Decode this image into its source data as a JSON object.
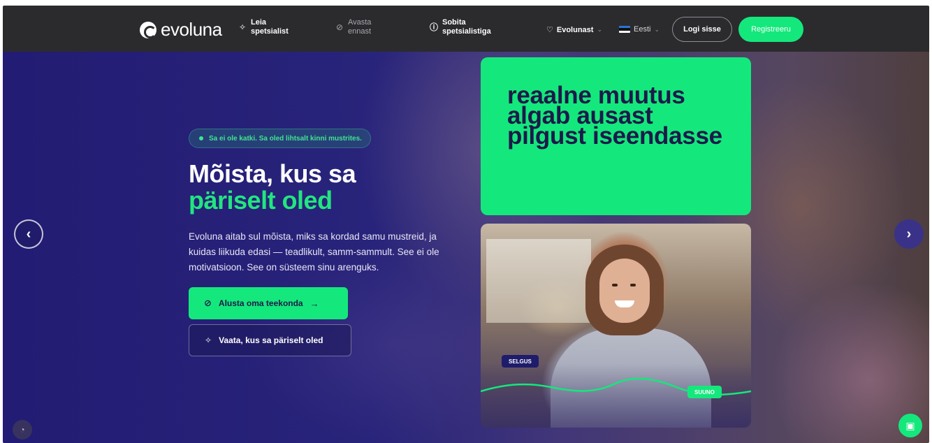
{
  "brand": {
    "name": "evoluna"
  },
  "nav": {
    "items": [
      {
        "line1": "Leia",
        "line2": "spetsialist",
        "icon": "sparkle-icon"
      },
      {
        "line1": "Avasta",
        "line2": "ennast",
        "icon": "compass-icon"
      },
      {
        "line1": "Sobita",
        "line2": "spetsialistiga",
        "icon": "info-icon"
      }
    ],
    "evolunast": "Evolunast",
    "language": "Eesti",
    "login": "Logi sisse",
    "register": "Registreeru"
  },
  "hero": {
    "tagline": "Sa ei ole katki. Sa oled lihtsalt kinni mustrites.",
    "headline_white": "Mõista, kus sa",
    "headline_green": "päriselt oled",
    "lead": "Evoluna aitab sul mõista, miks sa kordad samu mustreid, ja kuidas liikuda edasi — teadlikult, samm-sammult. See ei ole motivatsioon. See on süsteem sinu arenguks.",
    "cta_primary": "Alusta oma teekonda",
    "cta_secondary": "Vaata, kus sa päriselt oled",
    "quote": "reaalne muutus algab ausast pilgust iseendasse",
    "pill_left": "SELGUS",
    "pill_right": "SUUNO"
  },
  "colors": {
    "accent": "#14e87c",
    "navy": "#1d1a4a",
    "nav_bg": "#2b2b2e"
  }
}
